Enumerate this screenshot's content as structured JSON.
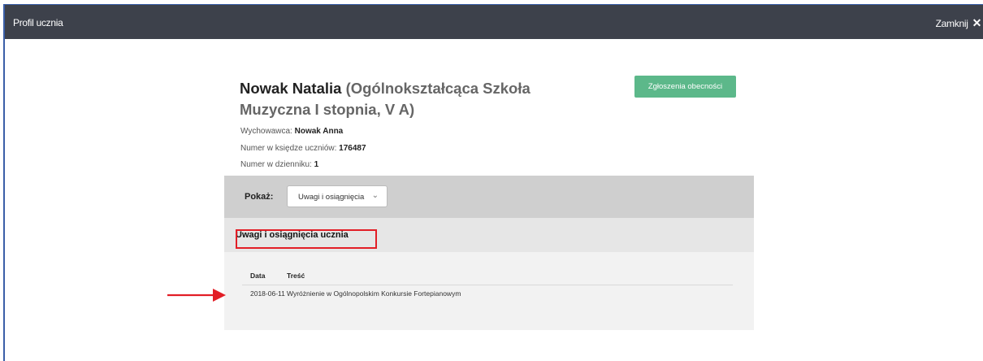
{
  "window": {
    "title": "Profil ucznia",
    "close_label": "Zamknij",
    "close_icon": "close-icon"
  },
  "student": {
    "name": "Nowak Natalia",
    "school_line1": "(Ogólnokształcąca Szkoła",
    "school_line2": "Muzyczna I stopnia, V A)",
    "tutor_label": "Wychowawca:",
    "tutor_value": "Nowak Anna",
    "book_number_label": "Numer w księdze uczniów:",
    "book_number_value": "176487",
    "diary_number_label": "Numer w dzienniku:",
    "diary_number_value": "1"
  },
  "actions": {
    "attendance_button": "Zgłoszenia obecności"
  },
  "filter": {
    "label": "Pokaż:",
    "selected": "Uwagi i osiągnięcia"
  },
  "section": {
    "title": "Uwagi i osiągnięcia ucznia"
  },
  "table": {
    "columns": [
      "Data",
      "Treść"
    ],
    "rows": [
      {
        "date": "2018-06-11",
        "content": "Wyróżnienie w Ogólnopolskim Konkursie Fortepianowym"
      }
    ]
  },
  "annotations": {
    "highlight_color": "#e21e26",
    "arrow_color": "#e21e26"
  },
  "colors": {
    "titlebar": "#3d414b",
    "accent_button": "#5cb88a"
  }
}
